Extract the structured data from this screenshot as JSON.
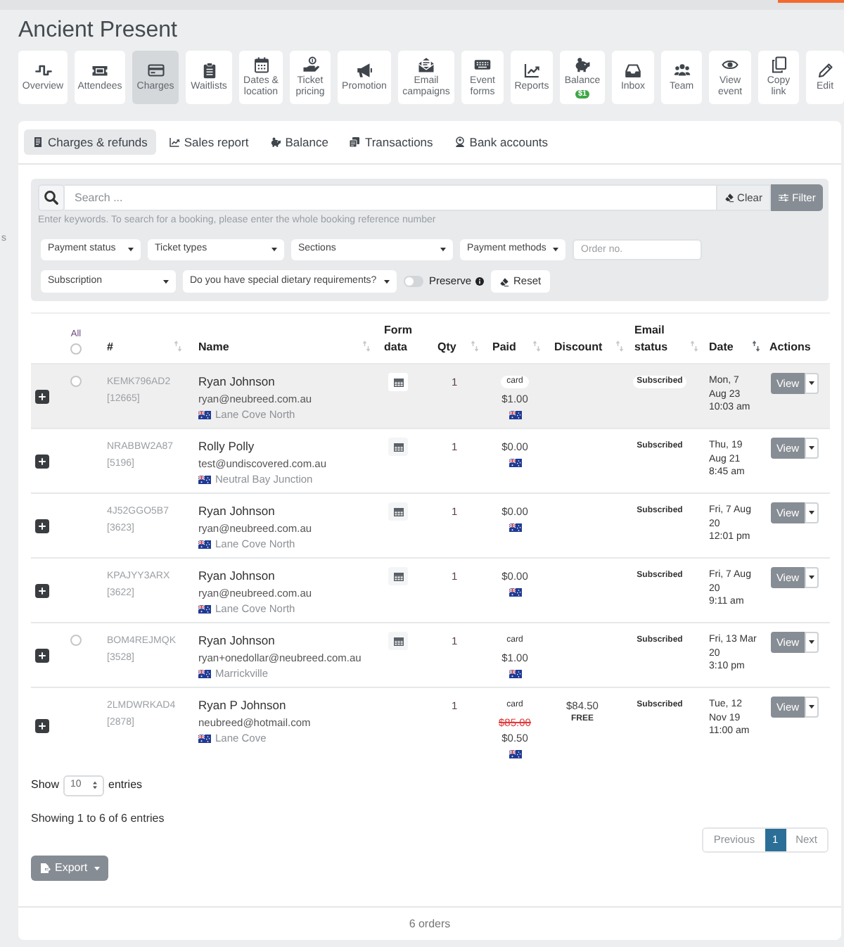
{
  "page": {
    "edge_text": "s",
    "title": "Ancient Present"
  },
  "toolbar": [
    {
      "label": "Overview",
      "selected": false
    },
    {
      "label": "Attendees",
      "selected": false
    },
    {
      "label": "Charges",
      "selected": true
    },
    {
      "label": "Waitlists",
      "selected": false
    },
    {
      "label": "Dates & location",
      "selected": false
    },
    {
      "label": "Ticket pricing",
      "selected": false
    },
    {
      "label": "Promotion",
      "selected": false
    },
    {
      "label": "Email campaigns",
      "selected": false
    },
    {
      "label": "Event forms",
      "selected": false
    },
    {
      "label": "Reports",
      "selected": false
    },
    {
      "label": "Balance",
      "selected": false,
      "badge": "$1"
    },
    {
      "label": "Inbox",
      "selected": false
    },
    {
      "label": "Team",
      "selected": false
    },
    {
      "label": "View event",
      "selected": false
    },
    {
      "label": "Copy link",
      "selected": false
    },
    {
      "label": "Edit",
      "selected": false
    }
  ],
  "tabs": [
    {
      "label": "Charges & refunds",
      "selected": true
    },
    {
      "label": "Sales report",
      "selected": false
    },
    {
      "label": "Balance",
      "selected": false
    },
    {
      "label": "Transactions",
      "selected": false
    },
    {
      "label": "Bank accounts",
      "selected": false
    }
  ],
  "search": {
    "placeholder": "Search ...",
    "clear": "Clear",
    "filter": "Filter",
    "hint": "Enter keywords. To search for a booking, please enter the whole booking reference number"
  },
  "filter_rows": [
    [
      {
        "kind": "select",
        "label": "Payment status"
      },
      {
        "kind": "select",
        "label": "Ticket types"
      },
      {
        "kind": "select",
        "label": "Sections"
      },
      {
        "kind": "select",
        "label": "Payment methods"
      },
      {
        "kind": "input",
        "placeholder": "Order no."
      }
    ],
    [
      {
        "kind": "select",
        "label": "Subscription"
      },
      {
        "kind": "select",
        "label": "Do you have special dietary requirements?"
      },
      {
        "kind": "toggle",
        "label": "Preserve",
        "on": false
      },
      {
        "kind": "button",
        "label": "Reset"
      }
    ]
  ],
  "table": {
    "select_all": {
      "label": "All",
      "checked": false
    },
    "columns": [
      {
        "label": "#",
        "sortable": true,
        "sorted": false
      },
      {
        "label": "Name",
        "sortable": true,
        "sorted": false
      },
      {
        "label": "Form data",
        "sortable": false
      },
      {
        "label": "Qty",
        "sortable": true,
        "sorted": false
      },
      {
        "label": "Paid",
        "sortable": true,
        "sorted": false
      },
      {
        "label": "Discount",
        "sortable": true,
        "sorted": false
      },
      {
        "label": "Email status",
        "sortable": true,
        "sorted": false
      },
      {
        "label": "Date",
        "sortable": true,
        "sorted": true
      },
      {
        "label": "Actions",
        "sortable": false
      }
    ],
    "rows": [
      {
        "highlighted": true,
        "selectable": true,
        "checked": false,
        "reference": "KEMK796AD2",
        "order_number": "[12665]",
        "name": "Ryan Johnson",
        "email": "ryan@neubreed.com.au",
        "location": "Lane Cove North",
        "form_data": true,
        "qty": "1",
        "payment_method": "card",
        "paid": "$1.00",
        "email_status": "Subscribed",
        "date_lines": [
          "Mon, 7",
          "Aug 23",
          "10:03 am"
        ],
        "action": "View"
      },
      {
        "highlighted": false,
        "selectable": false,
        "reference": "NRABBW2A87",
        "order_number": "[5196]",
        "name": "Rolly Polly",
        "email": "test@undiscovered.com.au",
        "location": "Neutral Bay Junction",
        "form_data": true,
        "qty": "1",
        "paid": "$0.00",
        "email_status": "Subscribed",
        "date_lines": [
          "Thu, 19",
          "Aug 21",
          "8:45 am"
        ],
        "action": "View"
      },
      {
        "highlighted": false,
        "selectable": false,
        "reference": "4J52GGO5B7",
        "order_number": "[3623]",
        "name": "Ryan Johnson",
        "email": "ryan@neubreed.com.au",
        "location": "Lane Cove North",
        "form_data": true,
        "qty": "1",
        "paid": "$0.00",
        "email_status": "Subscribed",
        "date_lines": [
          "Fri, 7 Aug",
          "20",
          "12:01 pm"
        ],
        "action": "View"
      },
      {
        "highlighted": false,
        "selectable": false,
        "reference": "KPAJYY3ARX",
        "order_number": "[3622]",
        "name": "Ryan Johnson",
        "email": "ryan@neubreed.com.au",
        "location": "Lane Cove North",
        "form_data": true,
        "qty": "1",
        "paid": "$0.00",
        "email_status": "Subscribed",
        "date_lines": [
          "Fri, 7 Aug",
          "20",
          "9:11 am"
        ],
        "action": "View"
      },
      {
        "highlighted": false,
        "selectable": true,
        "checked": false,
        "reference": "BOM4REJMQK",
        "order_number": "[3528]",
        "name": "Ryan Johnson",
        "email": "ryan+onedollar@neubreed.com.au",
        "location": "Marrickville",
        "form_data": true,
        "qty": "1",
        "payment_method": "card",
        "paid": "$1.00",
        "email_status": "Subscribed",
        "date_lines": [
          "Fri, 13 Mar",
          "20",
          "3:10 pm"
        ],
        "action": "View"
      },
      {
        "highlighted": false,
        "selectable": false,
        "reference": "2LMDWRKAD4",
        "order_number": "[2878]",
        "name": "Ryan P Johnson",
        "email": "neubreed@hotmail.com",
        "location": "Lane Cove",
        "form_data": false,
        "qty": "1",
        "payment_method": "card",
        "original_price": "$85.00",
        "paid": "$0.50",
        "discount": {
          "amount": "$84.50",
          "note": "FREE"
        },
        "email_status": "Subscribed",
        "date_lines": [
          "Tue, 12",
          "Nov 19",
          "11:00 am"
        ],
        "action": "View"
      }
    ]
  },
  "page_length": {
    "label_before": "Show",
    "value": "10",
    "label_after": "entries"
  },
  "info": "Showing 1 to 6 of 6 entries",
  "pagination": [
    {
      "kind": "previous",
      "label": "Previous",
      "selected": false,
      "disabled": true
    },
    {
      "kind": "page",
      "label": "1",
      "selected": true,
      "disabled": false
    },
    {
      "kind": "next",
      "label": "Next",
      "selected": false,
      "disabled": true
    }
  ],
  "export_button": "Export",
  "footer": "6 orders"
}
